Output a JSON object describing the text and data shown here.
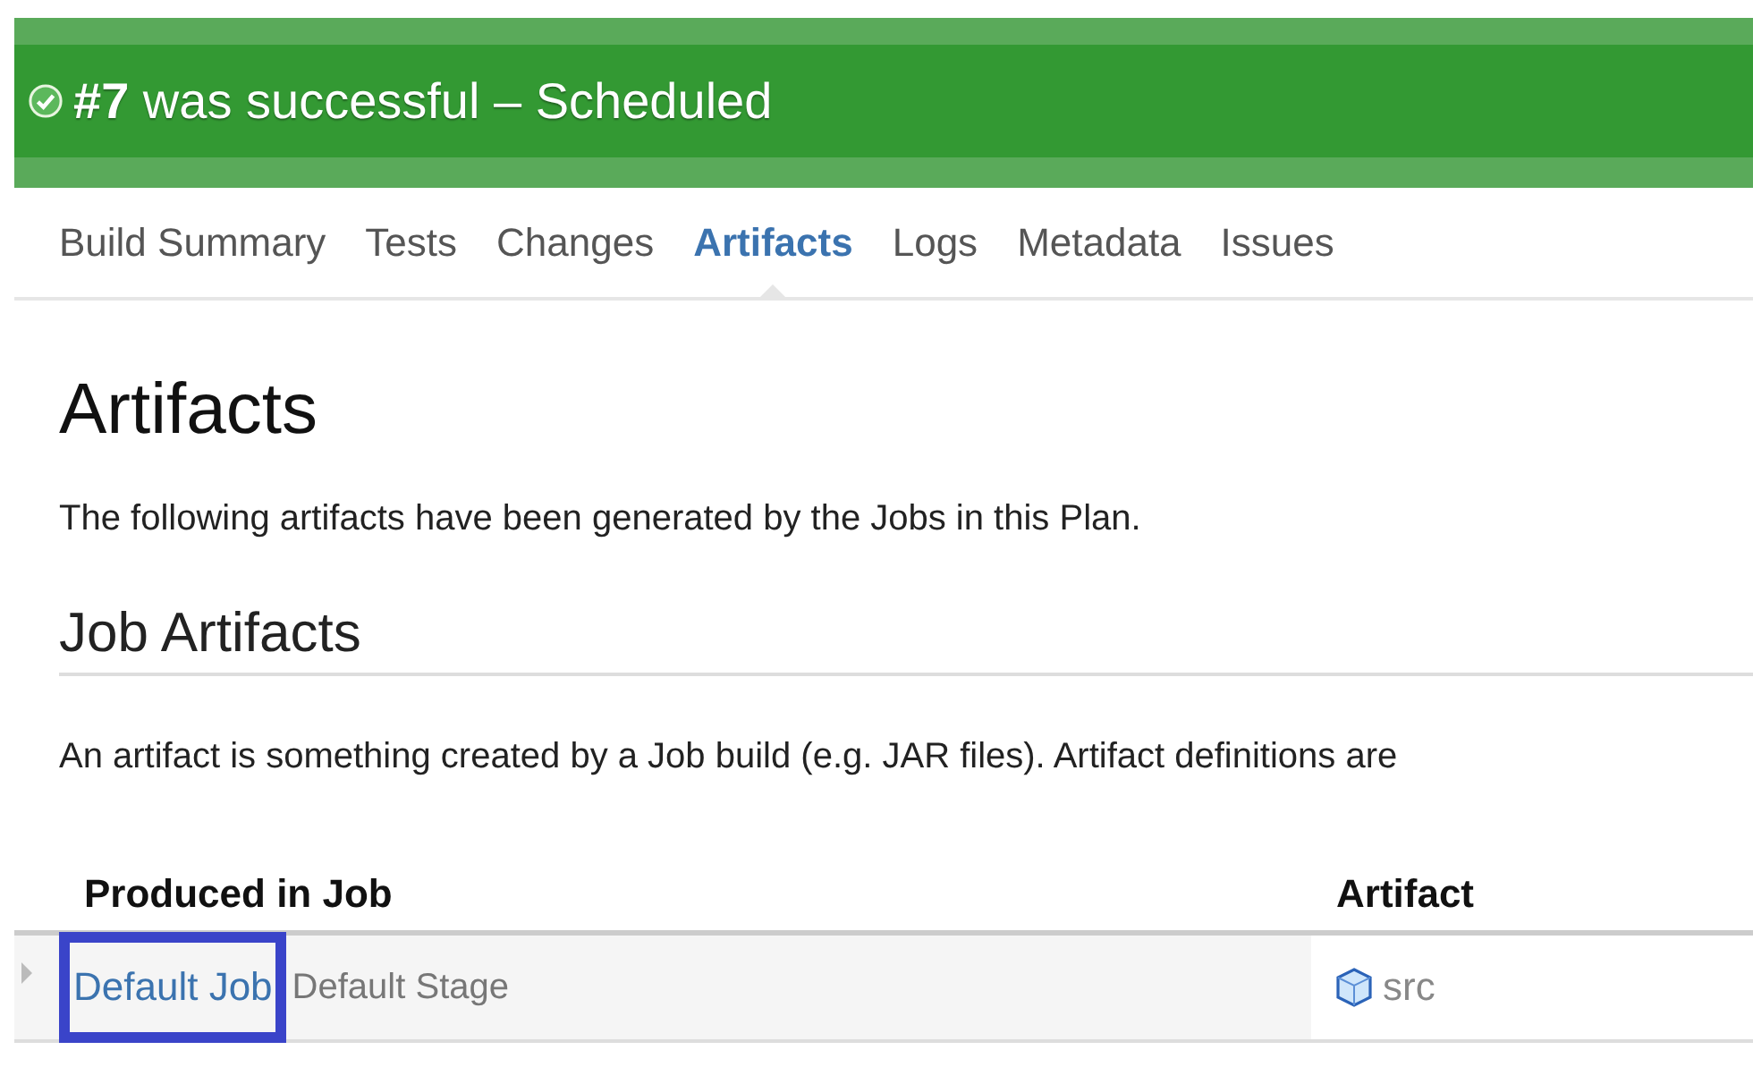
{
  "banner": {
    "build": "#7",
    "title": "was successful – Scheduled"
  },
  "tabs": [
    {
      "label": "Build Summary",
      "selected": false
    },
    {
      "label": "Tests",
      "selected": false
    },
    {
      "label": "Changes",
      "selected": false
    },
    {
      "label": "Artifacts",
      "selected": true
    },
    {
      "label": "Logs",
      "selected": false
    },
    {
      "label": "Metadata",
      "selected": false
    },
    {
      "label": "Issues",
      "selected": false
    }
  ],
  "heading": "Artifacts",
  "intro": "The following artifacts have been generated by the Jobs in this Plan.",
  "section": {
    "heading": "Job Artifacts",
    "description": "An artifact is something created by a Job build (e.g. JAR files). Artifact definitions are"
  },
  "table": {
    "columns": [
      "Produced in Job",
      "Artifact"
    ],
    "rows": [
      {
        "job": "Default Job",
        "stage": "Default Stage",
        "artifact": "src",
        "highlighted": true
      }
    ]
  }
}
